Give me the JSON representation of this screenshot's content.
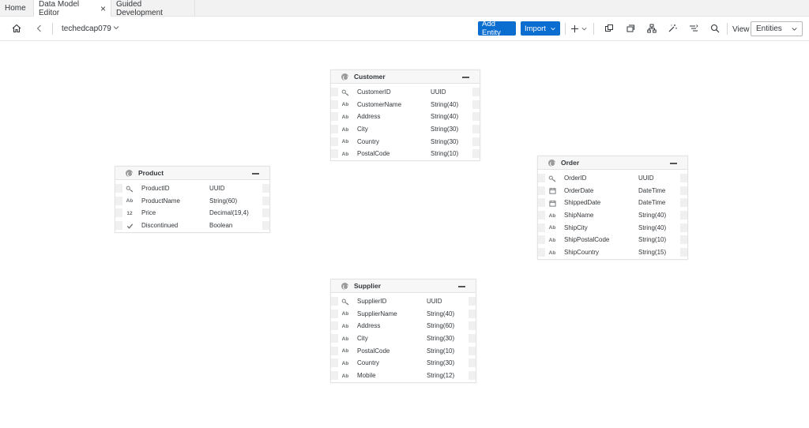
{
  "tabs": [
    {
      "label": "Home"
    },
    {
      "label": "Data Model Editor",
      "closable": true
    },
    {
      "label": "Guided Development"
    }
  ],
  "toolbar": {
    "breadcrumb": "techedcap079",
    "add_entity": "Add Entity",
    "import": "Import",
    "view_label": "View",
    "view_value": "Entities"
  },
  "icons": {
    "home": "home-icon",
    "back": "back-icon",
    "plus": "plus-icon",
    "copy1": "copy-icon",
    "copy2": "duplicate-icon",
    "hierarchy": "hierarchy-icon",
    "magic": "magic-wand-icon",
    "sort": "sort-icon",
    "search": "search-icon"
  },
  "colors": {
    "primary": "#0a6ed1"
  },
  "entities": {
    "customer": {
      "name": "Customer",
      "fields": [
        {
          "name": "CustomerID",
          "type": "UUID",
          "icon": "key"
        },
        {
          "name": "CustomerName",
          "type": "String(40)",
          "icon": "Ab"
        },
        {
          "name": "Address",
          "type": "String(40)",
          "icon": "Ab"
        },
        {
          "name": "City",
          "type": "String(30)",
          "icon": "Ab"
        },
        {
          "name": "Country",
          "type": "String(30)",
          "icon": "Ab"
        },
        {
          "name": "PostalCode",
          "type": "String(10)",
          "icon": "Ab"
        }
      ]
    },
    "product": {
      "name": "Product",
      "fields": [
        {
          "name": "ProductID",
          "type": "UUID",
          "icon": "key"
        },
        {
          "name": "ProductName",
          "type": "String(60)",
          "icon": "Ab"
        },
        {
          "name": "Price",
          "type": "Decimal(19,4)",
          "icon": "12"
        },
        {
          "name": "Discontinued",
          "type": "Boolean",
          "icon": "check"
        }
      ]
    },
    "order": {
      "name": "Order",
      "fields": [
        {
          "name": "OrderID",
          "type": "UUID",
          "icon": "key"
        },
        {
          "name": "OrderDate",
          "type": "DateTime",
          "icon": "calendar"
        },
        {
          "name": "ShippedDate",
          "type": "DateTime",
          "icon": "calendar"
        },
        {
          "name": "ShipName",
          "type": "String(40)",
          "icon": "Ab"
        },
        {
          "name": "ShipCity",
          "type": "String(40)",
          "icon": "Ab"
        },
        {
          "name": "ShipPostalCode",
          "type": "String(10)",
          "icon": "Ab"
        },
        {
          "name": "ShipCountry",
          "type": "String(15)",
          "icon": "Ab"
        }
      ]
    },
    "supplier": {
      "name": "Supplier",
      "fields": [
        {
          "name": "SupplierID",
          "type": "UUID",
          "icon": "key"
        },
        {
          "name": "SupplierName",
          "type": "String(40)",
          "icon": "Ab"
        },
        {
          "name": "Address",
          "type": "String(60)",
          "icon": "Ab"
        },
        {
          "name": "City",
          "type": "String(30)",
          "icon": "Ab"
        },
        {
          "name": "PostalCode",
          "type": "String(10)",
          "icon": "Ab"
        },
        {
          "name": "Country",
          "type": "String(30)",
          "icon": "Ab"
        },
        {
          "name": "Mobile",
          "type": "String(12)",
          "icon": "Ab"
        }
      ]
    }
  }
}
